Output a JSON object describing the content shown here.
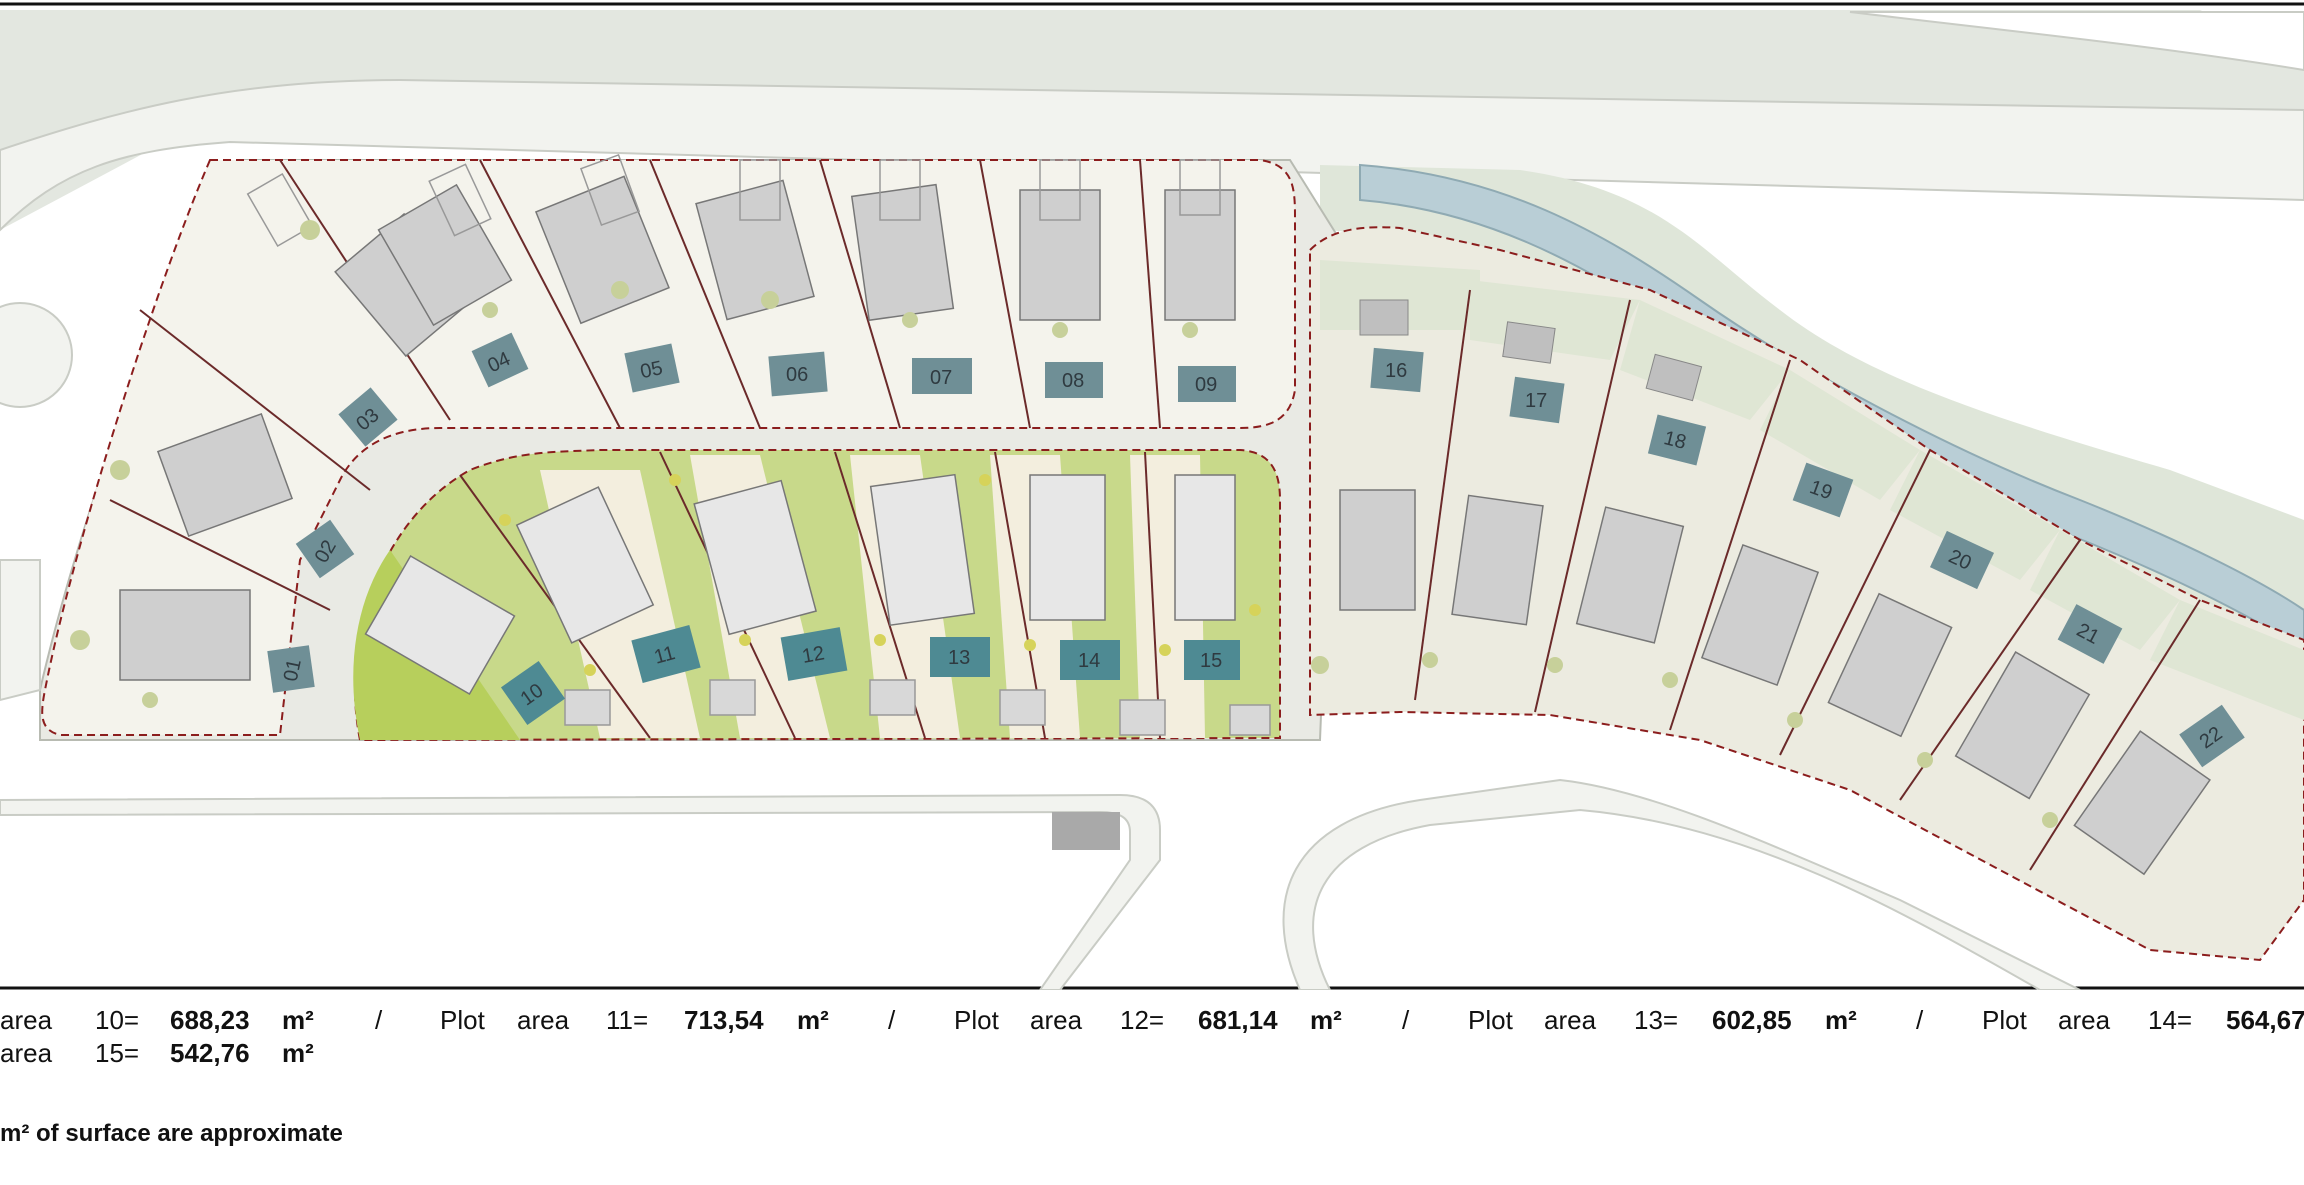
{
  "plots_top": [
    {
      "id": "p01",
      "label": "01"
    },
    {
      "id": "p02",
      "label": "02"
    },
    {
      "id": "p03",
      "label": "03"
    },
    {
      "id": "p04",
      "label": "04"
    },
    {
      "id": "p05",
      "label": "05"
    },
    {
      "id": "p06",
      "label": "06"
    },
    {
      "id": "p07",
      "label": "07"
    },
    {
      "id": "p08",
      "label": "08"
    },
    {
      "id": "p09",
      "label": "09"
    }
  ],
  "plots_middle": [
    {
      "id": "p10",
      "label": "10"
    },
    {
      "id": "p11",
      "label": "11"
    },
    {
      "id": "p12",
      "label": "12"
    },
    {
      "id": "p13",
      "label": "13"
    },
    {
      "id": "p14",
      "label": "14"
    },
    {
      "id": "p15",
      "label": "15"
    }
  ],
  "plots_right": [
    {
      "id": "p16",
      "label": "16"
    },
    {
      "id": "p17",
      "label": "17"
    },
    {
      "id": "p18",
      "label": "18"
    },
    {
      "id": "p19",
      "label": "19"
    },
    {
      "id": "p20",
      "label": "20"
    },
    {
      "id": "p21",
      "label": "21"
    },
    {
      "id": "p22",
      "label": "22"
    }
  ],
  "caption": {
    "row1": [
      {
        "word": "area",
        "num": "10=",
        "value": "688,23",
        "unit": "m²",
        "sep": "/"
      },
      {
        "word": "Plot",
        "word2": "area",
        "num": "11=",
        "value": "713,54",
        "unit": "m²",
        "sep": "/"
      },
      {
        "word": "Plot",
        "word2": "area",
        "num": "12=",
        "value": "681,14",
        "unit": "m²",
        "sep": "/"
      },
      {
        "word": "Plot",
        "word2": "area",
        "num": "13=",
        "value": "602,85",
        "unit": "m²",
        "sep": "/"
      },
      {
        "word": "Plot",
        "word2": "area",
        "num": "14=",
        "value": "564,67"
      }
    ],
    "row2": {
      "word": "area",
      "num": "15=",
      "value": "542,76",
      "unit": "m²"
    },
    "note": "m² of surface are approximate"
  },
  "colors": {
    "plot_label_fill": "#6f8f96",
    "plot_label_fill_dark": "#4e8a93",
    "grass": "#c8d98a",
    "grass_dark": "#b7cf5c",
    "paving": "#ecebe0",
    "green_verge": "#dfe6d4",
    "river": "#b9ced6",
    "boundary": "#8b1d1d"
  }
}
